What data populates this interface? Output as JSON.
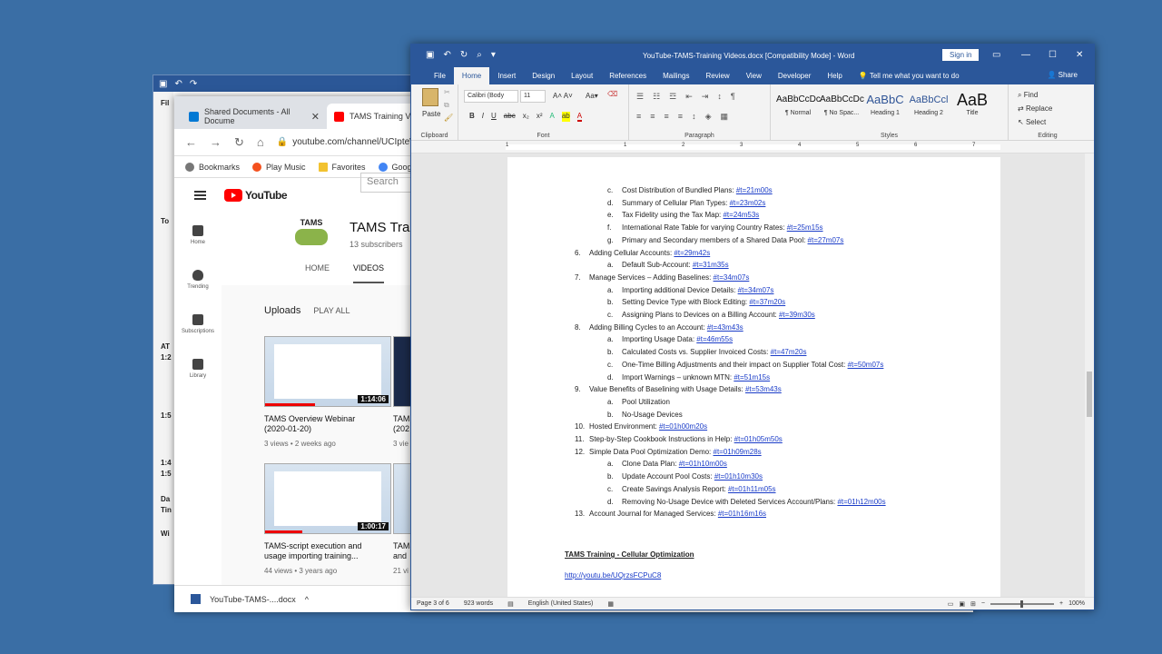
{
  "back_window": {
    "left_labels": [
      "Fil",
      "To",
      "AT",
      "1:2",
      "1:5",
      "1:4",
      "1:5",
      "Da",
      "Tin",
      "Wi"
    ]
  },
  "chrome": {
    "tabs": [
      {
        "label": "Shared Documents - All Docume",
        "color": "#0078d4"
      },
      {
        "label": "TAMS Training Vide",
        "color": "#ff0000"
      }
    ],
    "url": "youtube.com/channel/UCIpteW_r",
    "bookmarks": [
      {
        "label": "Bookmarks",
        "color": "#777777"
      },
      {
        "label": "Play Music",
        "color": "#f4511e"
      },
      {
        "label": "Favorites",
        "color": "#f2c230"
      },
      {
        "label": "Google",
        "color": "#4285f4"
      }
    ]
  },
  "youtube": {
    "logo_text": "YouTube",
    "search_placeholder": "Search",
    "sidebar": [
      {
        "label": "Home",
        "icon": "home-icon"
      },
      {
        "label": "Trending",
        "icon": "trending-icon"
      },
      {
        "label": "Subscriptions",
        "icon": "subscriptions-icon"
      },
      {
        "label": "Library",
        "icon": "library-icon"
      }
    ],
    "channel": {
      "logo_text": "TAMS",
      "name": "TAMS Tra",
      "subscribers": "13 subscribers",
      "tabs": [
        "HOME",
        "VIDEOS"
      ]
    },
    "uploads_label": "Uploads",
    "play_all": "PLAY ALL",
    "videos": [
      {
        "title_line1": "TAMS Overview Webinar",
        "title_line2": "(2020-01-20)",
        "meta": "3 views • 2 weeks ago",
        "duration": "1:14:06"
      },
      {
        "title_line1": "TAMS",
        "title_line2": "(202",
        "meta": "3 vie",
        "duration": ""
      },
      {
        "title_line1": "TAMS-script execution and",
        "title_line2": "usage importing training...",
        "meta": "44 views • 3 years ago",
        "duration": "1:00:17"
      },
      {
        "title_line1": "TAMS",
        "title_line2": "and",
        "meta": "21 vi",
        "duration": ""
      }
    ],
    "download": "YouTube-TAMS-....docx"
  },
  "word": {
    "title": "YouTube-TAMS-Training Videos.docx [Compatibility Mode]  -  Word",
    "signin": "Sign in",
    "tabs": [
      "File",
      "Home",
      "Insert",
      "Design",
      "Layout",
      "References",
      "Mailings",
      "Review",
      "View",
      "Developer",
      "Help"
    ],
    "tell_me": "Tell me what you want to do",
    "share": "Share",
    "ribbon": {
      "paste": "Paste",
      "clipboard": "Clipboard",
      "font_name": "Calibri (Body",
      "font_size": "11",
      "font": "Font",
      "paragraph": "Paragraph",
      "styles": [
        {
          "preview": "AaBbCcDc",
          "name": "¶ Normal"
        },
        {
          "preview": "AaBbCcDc",
          "name": "¶ No Spac..."
        },
        {
          "preview": "AaBbC",
          "name": "Heading 1"
        },
        {
          "preview": "AaBbCcl",
          "name": "Heading 2"
        },
        {
          "preview": "AaB",
          "name": "Title"
        }
      ],
      "styles_label": "Styles",
      "find": "Find",
      "replace": "Replace",
      "select": "Select",
      "editing": "Editing"
    },
    "ruler_numbers": [
      "1",
      "1",
      "2",
      "3",
      "4",
      "5",
      "6",
      "7"
    ],
    "lines": [
      {
        "marker": "c.",
        "text": "Cost Distribution of Bundled Plans: ",
        "link": "#t=21m00s",
        "level": 2
      },
      {
        "marker": "d.",
        "text": "Summary of Cellular Plan Types: ",
        "link": "#t=23m02s",
        "level": 2
      },
      {
        "marker": "e.",
        "text": "Tax Fidelity using the Tax Map: ",
        "link": "#t=24m53s",
        "level": 2
      },
      {
        "marker": "f.",
        "text": "International Rate Table for varying Country Rates: ",
        "link": "#t=25m15s",
        "level": 2
      },
      {
        "marker": "g.",
        "text": "Primary and Secondary members of a Shared Data Pool: ",
        "link": "#t=27m07s",
        "level": 2
      },
      {
        "marker": "6.",
        "text": "Adding Cellular Accounts: ",
        "link": "#t=29m42s",
        "level": 1
      },
      {
        "marker": "a.",
        "text": "Default Sub-Account: ",
        "link": "#t=31m35s",
        "level": 2
      },
      {
        "marker": "7.",
        "text": "Manage Services – Adding Baselines: ",
        "link": "#t=34m07s",
        "level": 1
      },
      {
        "marker": "a.",
        "text": "Importing additional Device Details:  ",
        "link": "#t=34m07s",
        "level": 2
      },
      {
        "marker": "b.",
        "text": "Setting Device Type with Block Editing:  ",
        "link": "#t=37m20s",
        "level": 2
      },
      {
        "marker": "c.",
        "text": "Assigning Plans to Devices on a Billing Account:  ",
        "link": "#t=39m30s",
        "level": 2
      },
      {
        "marker": "8.",
        "text": "Adding Billing Cycles to an Account: ",
        "link": "#t=43m43s",
        "level": 1
      },
      {
        "marker": "a.",
        "text": "Importing Usage Data:  ",
        "link": "#t=46m55s",
        "level": 2
      },
      {
        "marker": "b.",
        "text": "Calculated Costs vs. Supplier Invoiced Costs:  ",
        "link": "#t=47m20s",
        "level": 2
      },
      {
        "marker": "c.",
        "text": "One-Time Billing Adjustments and their impact on Supplier Total Cost:  ",
        "link": "#t=50m07s",
        "level": 2
      },
      {
        "marker": "d.",
        "text": "Import Warnings – unknown MTN:  ",
        "link": "#t=51m15s",
        "level": 2
      },
      {
        "marker": "9.",
        "text": "Value Benefits of Baselining with Usage Details: ",
        "link": "#t=53m43s",
        "level": 1
      },
      {
        "marker": "a.",
        "text": "Pool Utilization",
        "link": "",
        "level": 2
      },
      {
        "marker": "b.",
        "text": "No-Usage Devices",
        "link": "",
        "level": 2
      },
      {
        "marker": "10.",
        "text": "Hosted Environment: ",
        "link": "#t=01h00m20s",
        "level": 1
      },
      {
        "marker": "11.",
        "text": "Step-by-Step Cookbook Instructions in Help: ",
        "link": "#t=01h05m50s",
        "level": 1
      },
      {
        "marker": "12.",
        "text": "Simple Data Pool Optimization Demo: ",
        "link": "#t=01h09m28s",
        "level": 1
      },
      {
        "marker": "a.",
        "text": "Clone Data Plan: ",
        "link": "#t=01h10m00s",
        "level": 2
      },
      {
        "marker": "b.",
        "text": "Update Account Pool Costs: ",
        "link": "#t=01h10m30s",
        "level": 2
      },
      {
        "marker": "c.",
        "text": "Create Savings Analysis Report: ",
        "link": "#t=01h11m05s",
        "level": 2
      },
      {
        "marker": "d.",
        "text": "Removing No-Usage Device with Deleted Services Account/Plans: ",
        "link": "#t=01h12m00s",
        "level": 2
      },
      {
        "marker": "13.",
        "text": "Account Journal for Managed Services: ",
        "link": "#t=01h16m16s",
        "level": 1
      }
    ],
    "section_heading": "TAMS Training - Cellular Optimization",
    "section_link": "http://youtu.be/UQrzsFCPuC8",
    "status": {
      "page": "Page 3 of 6",
      "words": "923 words",
      "language": "English (United States)",
      "zoom": "100%"
    }
  }
}
